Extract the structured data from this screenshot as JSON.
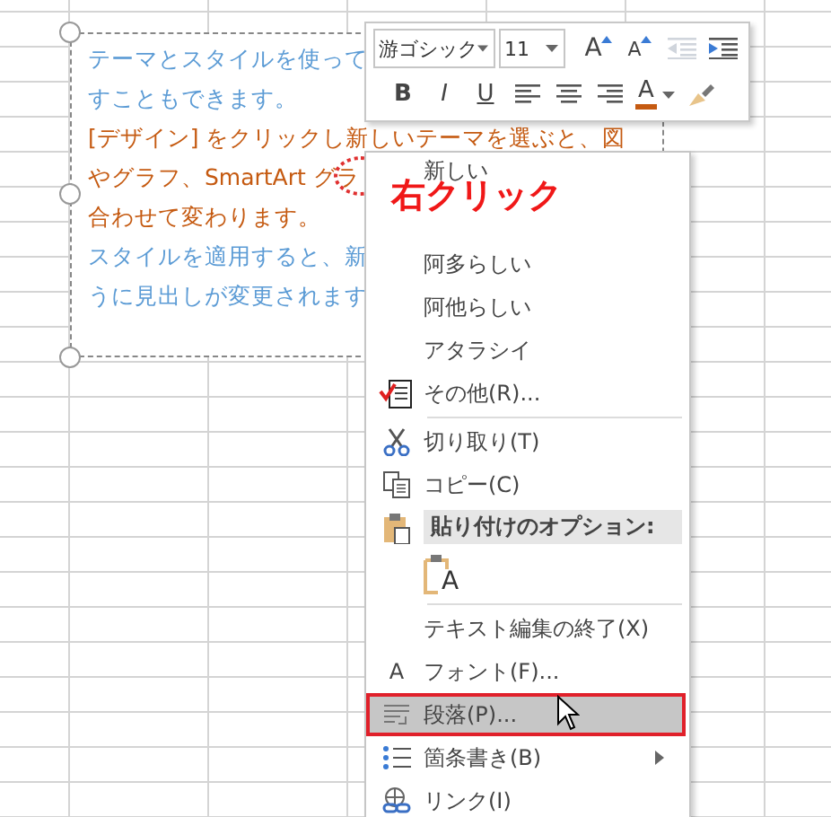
{
  "text_box": {
    "lines": [
      {
        "text": "テーマとスタイルを使って",
        "color": "#5b9bd5"
      },
      {
        "text": "すこともできます。",
        "color": "#5b9bd5"
      },
      {
        "text": "[デザイン] をクリックし新しいテーマを選ぶと、図",
        "color": "#c55a11"
      },
      {
        "text": "やグラフ、SmartArt グラ",
        "color": "#c55a11"
      },
      {
        "text": "合わせて変わります。",
        "color": "#c55a11"
      },
      {
        "text": "スタイルを適用すると、新",
        "color": "#5b9bd5"
      },
      {
        "text": "うに見出しが変更されます",
        "color": "#5b9bd5"
      }
    ]
  },
  "mini_toolbar": {
    "font": "游ゴシック",
    "size": "11",
    "top_buttons": [
      {
        "kind": "grow",
        "label": "A",
        "disabled": false
      },
      {
        "kind": "shrink",
        "label": "A",
        "disabled": false
      },
      {
        "kind": "outdent",
        "disabled": true
      },
      {
        "kind": "indent",
        "disabled": false
      }
    ],
    "format_buttons": [
      {
        "kind": "bold",
        "label": "B"
      },
      {
        "kind": "italic",
        "label": "I"
      },
      {
        "kind": "underline",
        "label": "U"
      },
      {
        "kind": "align-left"
      },
      {
        "kind": "align-center"
      },
      {
        "kind": "align-right"
      },
      {
        "kind": "font-color",
        "label": "A"
      },
      {
        "kind": "painter"
      }
    ]
  },
  "context_menu": {
    "items": [
      {
        "kind": "candidate",
        "label": "新しい",
        "selected": false,
        "separator_before": false
      },
      {
        "kind": "candidate",
        "label": "阿多らしい",
        "selected": false,
        "separator_before": false
      },
      {
        "kind": "candidate",
        "label": "阿他らしい",
        "selected": false,
        "separator_before": false
      },
      {
        "kind": "candidate",
        "label": "アタラシイ",
        "selected": false,
        "separator_before": false
      },
      {
        "kind": "more",
        "label": "その他(R)...",
        "selected": false,
        "separator_before": false
      },
      {
        "kind": "cut",
        "label": "切り取り(T)",
        "selected": false,
        "separator_before": true
      },
      {
        "kind": "copy",
        "label": "コピー(C)",
        "selected": false,
        "separator_before": false
      },
      {
        "kind": "paste-header",
        "label": "貼り付けのオプション:",
        "selected": false,
        "separator_before": false
      },
      {
        "kind": "paste-option",
        "label": "A",
        "selected": false,
        "separator_before": false
      },
      {
        "kind": "command",
        "label": "テキスト編集の終了(X)",
        "selected": false,
        "separator_before": true
      },
      {
        "kind": "font",
        "glyph": "A",
        "label": "フォント(F)...",
        "selected": false,
        "separator_before": false
      },
      {
        "kind": "paragraph",
        "label": "段落(P)...",
        "selected": true,
        "separator_before": false
      },
      {
        "kind": "bullets",
        "label": "箇条書き(B)",
        "selected": false,
        "separator_before": false,
        "submenu": true
      },
      {
        "kind": "link",
        "label": "リンク(I)",
        "selected": false,
        "separator_before": false
      }
    ]
  },
  "annotation": {
    "label": "右クリック"
  }
}
